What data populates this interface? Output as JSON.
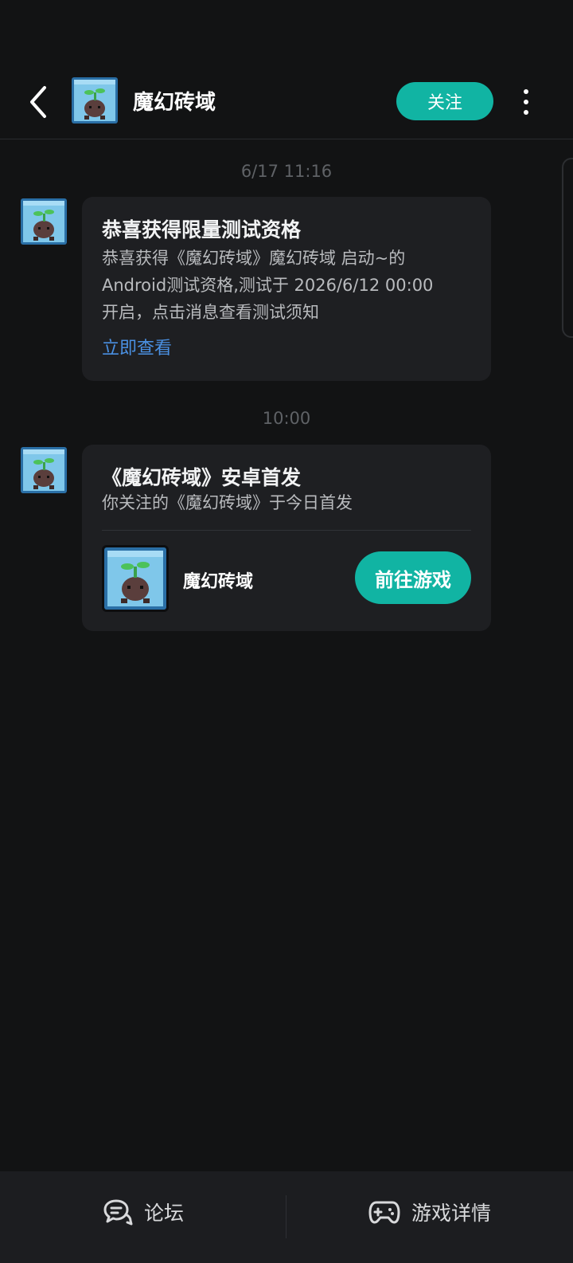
{
  "header": {
    "title": "魔幻砖域",
    "follow_label": "关注",
    "back_icon": "back-chevron-icon",
    "more_icon": "more-vertical-icon"
  },
  "messages": [
    {
      "timestamp": "6/17  11:16",
      "title": "恭喜获得限量测试资格",
      "body_lines": [
        "恭喜获得《魔幻砖域》魔幻砖域 启动~的",
        "Android测试资格,测试于 2026/6/12 00:00",
        "开启，点击消息查看测试须知"
      ],
      "link_label": "立即查看"
    },
    {
      "timestamp": "10:00",
      "title": "《魔幻砖域》安卓首发",
      "body": "你关注的《魔幻砖域》于今日首发",
      "game_name": "魔幻砖域",
      "action_label": "前往游戏"
    }
  ],
  "bottom_bar": {
    "forum_label": "论坛",
    "details_label": "游戏详情"
  },
  "colors": {
    "accent": "#11b4a3",
    "link": "#4a90e2",
    "background": "#121314",
    "card": "#1e1f22"
  }
}
